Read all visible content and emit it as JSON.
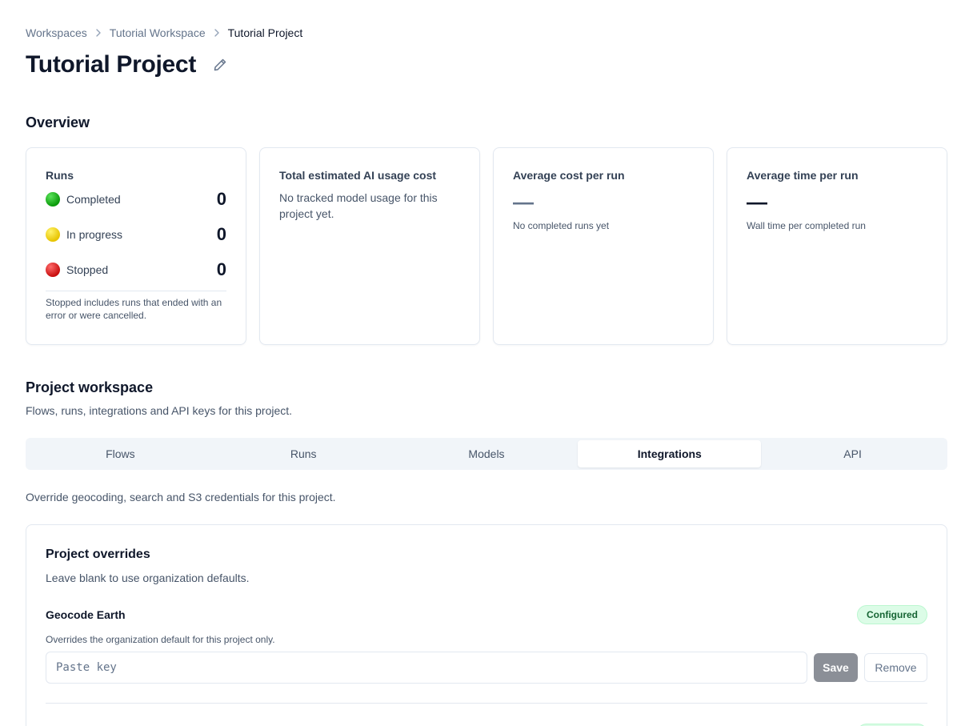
{
  "breadcrumb": {
    "items": [
      "Workspaces",
      "Tutorial Workspace",
      "Tutorial Project"
    ]
  },
  "page": {
    "title": "Tutorial Project"
  },
  "overview": {
    "title": "Overview",
    "runs": {
      "label": "Runs",
      "completed_label": "Completed",
      "completed_count": "0",
      "in_progress_label": "In progress",
      "in_progress_count": "0",
      "stopped_label": "Stopped",
      "stopped_count": "0",
      "note": "Stopped includes runs that ended with an error or were cancelled."
    },
    "cost": {
      "label": "Total estimated AI usage cost",
      "text": "No tracked model usage for this project yet."
    },
    "avg_cost": {
      "label": "Average cost per run",
      "value": "—",
      "note": "No completed runs yet"
    },
    "avg_time": {
      "label": "Average time per run",
      "value": "—",
      "note": "Wall time per completed run"
    }
  },
  "workspace": {
    "title": "Project workspace",
    "subtitle": "Flows, runs, integrations and API keys for this project.",
    "tabs": [
      {
        "label": "Flows",
        "active": false
      },
      {
        "label": "Runs",
        "active": false
      },
      {
        "label": "Models",
        "active": false
      },
      {
        "label": "Integrations",
        "active": true
      },
      {
        "label": "API",
        "active": false
      }
    ],
    "tab_description": "Override geocoding, search and S3 credentials for this project."
  },
  "overrides": {
    "title": "Project overrides",
    "subtitle": "Leave blank to use organization defaults.",
    "geocode": {
      "name": "Geocode Earth",
      "status": "Configured",
      "description": "Overrides the organization default for this project only.",
      "placeholder": "Paste key",
      "value": "",
      "save_label": "Save",
      "remove_label": "Remove"
    }
  },
  "colors": {
    "accent": "#0f172a",
    "completed": "#16a316",
    "in_progress": "#f0cf00",
    "stopped": "#d61414",
    "badge_bg": "#dcfce7",
    "badge_text": "#166534"
  }
}
